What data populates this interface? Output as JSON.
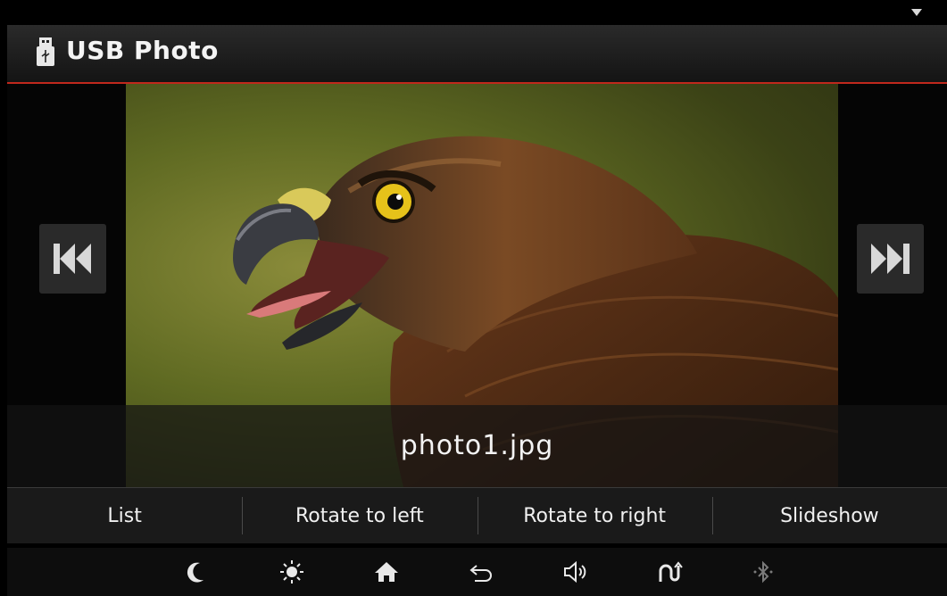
{
  "header": {
    "title": "USB Photo",
    "icon": "usb-icon"
  },
  "photo": {
    "filename": "photo1.jpg"
  },
  "navigation": {
    "prev_icon": "skip-previous-icon",
    "next_icon": "skip-next-icon"
  },
  "actions": [
    {
      "label": "List"
    },
    {
      "label": "Rotate to left"
    },
    {
      "label": "Rotate to right"
    },
    {
      "label": "Slideshow"
    }
  ],
  "system_bar": {
    "icons": [
      "moon-icon",
      "brightness-icon",
      "home-icon",
      "back-icon",
      "volume-icon",
      "navigation-icon",
      "bluetooth-icon"
    ]
  },
  "colors": {
    "accent": "#c0281c",
    "background": "#000000"
  }
}
